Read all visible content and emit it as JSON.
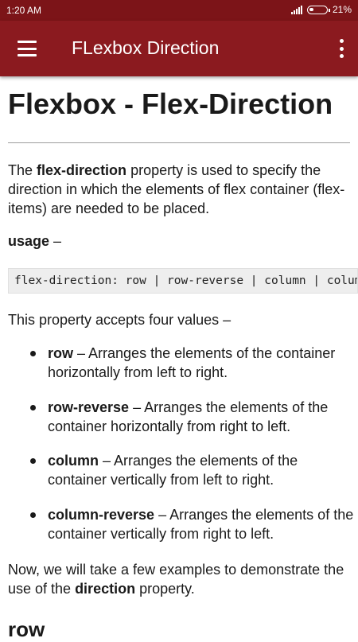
{
  "status_bar": {
    "time": "1:20 AM",
    "battery": "21%",
    "icons": [
      "signal-icon",
      "battery-icon"
    ]
  },
  "app_bar": {
    "title": "FLexbox Direction",
    "menu_icon": "hamburger-menu-icon",
    "overflow_icon": "more-vert-icon",
    "color": "#8b1a1f"
  },
  "article": {
    "heading": "Flexbox - Flex-Direction",
    "intro": {
      "before": "The ",
      "bold": "flex-direction",
      "after": " property is used to specify the direction in which the elements of flex container (flex-items) are needed to be placed."
    },
    "usage_label": "usage",
    "usage_dash": " –",
    "code": "flex-direction: row | row-reverse | column | column-reverse",
    "accepts_text": "This property accepts four values –",
    "values": [
      {
        "name": "row",
        "desc": " – Arranges the elements of the container horizontally from left to right."
      },
      {
        "name": "row-reverse",
        "desc": " – Arranges the elements of the container horizontally from right to left."
      },
      {
        "name": "column",
        "desc": " – Arranges the elements of the container vertically from left to right."
      },
      {
        "name": "column-reverse",
        "desc": " – Arranges the elements of the container vertically from right to left."
      }
    ],
    "examples": {
      "before": "Now, we will take a few examples to demonstrate the use of the ",
      "bold": "direction",
      "after": " property."
    },
    "section_heading": "row"
  }
}
